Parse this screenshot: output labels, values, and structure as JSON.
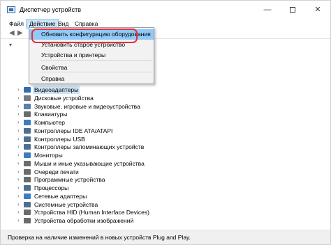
{
  "window": {
    "title": "Диспетчер устройств",
    "minimize": "—",
    "close": "✕"
  },
  "menubar": {
    "file": "Файл",
    "action": "Действие",
    "view": "Вид",
    "help": "Справка"
  },
  "toolbar": {
    "back": "◀",
    "forward": "▶"
  },
  "dropdown": {
    "items": [
      "Обновить конфигурацию оборудования",
      "Установить старое устройство",
      "Устройства и принтеры",
      "Свойства",
      "Справка"
    ]
  },
  "tree": {
    "root_arrow": "▾",
    "chevron": "›",
    "items": [
      {
        "label": "Видеоадаптеры",
        "icon": "display-adapter-icon",
        "color": "#2f6fb0"
      },
      {
        "label": "Дисковые устройства",
        "icon": "disk-drive-icon",
        "color": "#7a7a7a"
      },
      {
        "label": "Звуковые, игровые и видеоустройства",
        "icon": "speaker-icon",
        "color": "#5a7fa8"
      },
      {
        "label": "Клавиатуры",
        "icon": "keyboard-icon",
        "color": "#6b6b6b"
      },
      {
        "label": "Компьютер",
        "icon": "computer-icon",
        "color": "#3e7cc0"
      },
      {
        "label": "Контроллеры IDE ATA/ATAPI",
        "icon": "ide-controller-icon",
        "color": "#4f6f8f"
      },
      {
        "label": "Контроллеры USB",
        "icon": "usb-controller-icon",
        "color": "#4f6f8f"
      },
      {
        "label": "Контроллеры запоминающих устройств",
        "icon": "storage-controller-icon",
        "color": "#4f6f8f"
      },
      {
        "label": "Мониторы",
        "icon": "monitor-icon",
        "color": "#3e7cc0"
      },
      {
        "label": "Мыши и иные указывающие устройства",
        "icon": "mouse-icon",
        "color": "#6b6b6b"
      },
      {
        "label": "Очереди печати",
        "icon": "printer-icon",
        "color": "#6b6b6b"
      },
      {
        "label": "Программные устройства",
        "icon": "software-device-icon",
        "color": "#6b6b6b"
      },
      {
        "label": "Процессоры",
        "icon": "processor-icon",
        "color": "#4f6f8f"
      },
      {
        "label": "Сетевые адаптеры",
        "icon": "network-adapter-icon",
        "color": "#3e7cc0"
      },
      {
        "label": "Системные устройства",
        "icon": "system-device-icon",
        "color": "#4f6f8f"
      },
      {
        "label": "Устройства HID (Human Interface Devices)",
        "icon": "hid-icon",
        "color": "#6b6b6b"
      },
      {
        "label": "Устройства обработки изображений",
        "icon": "camera-icon",
        "color": "#6b6b6b"
      }
    ]
  },
  "statusbar": {
    "text": "Проверка на наличие изменений в новых устройств Plug and Play."
  },
  "colors": {
    "highlight": "#91c9f7",
    "focus_ring": "#e0303a",
    "menu_active": "#cce4f7"
  }
}
